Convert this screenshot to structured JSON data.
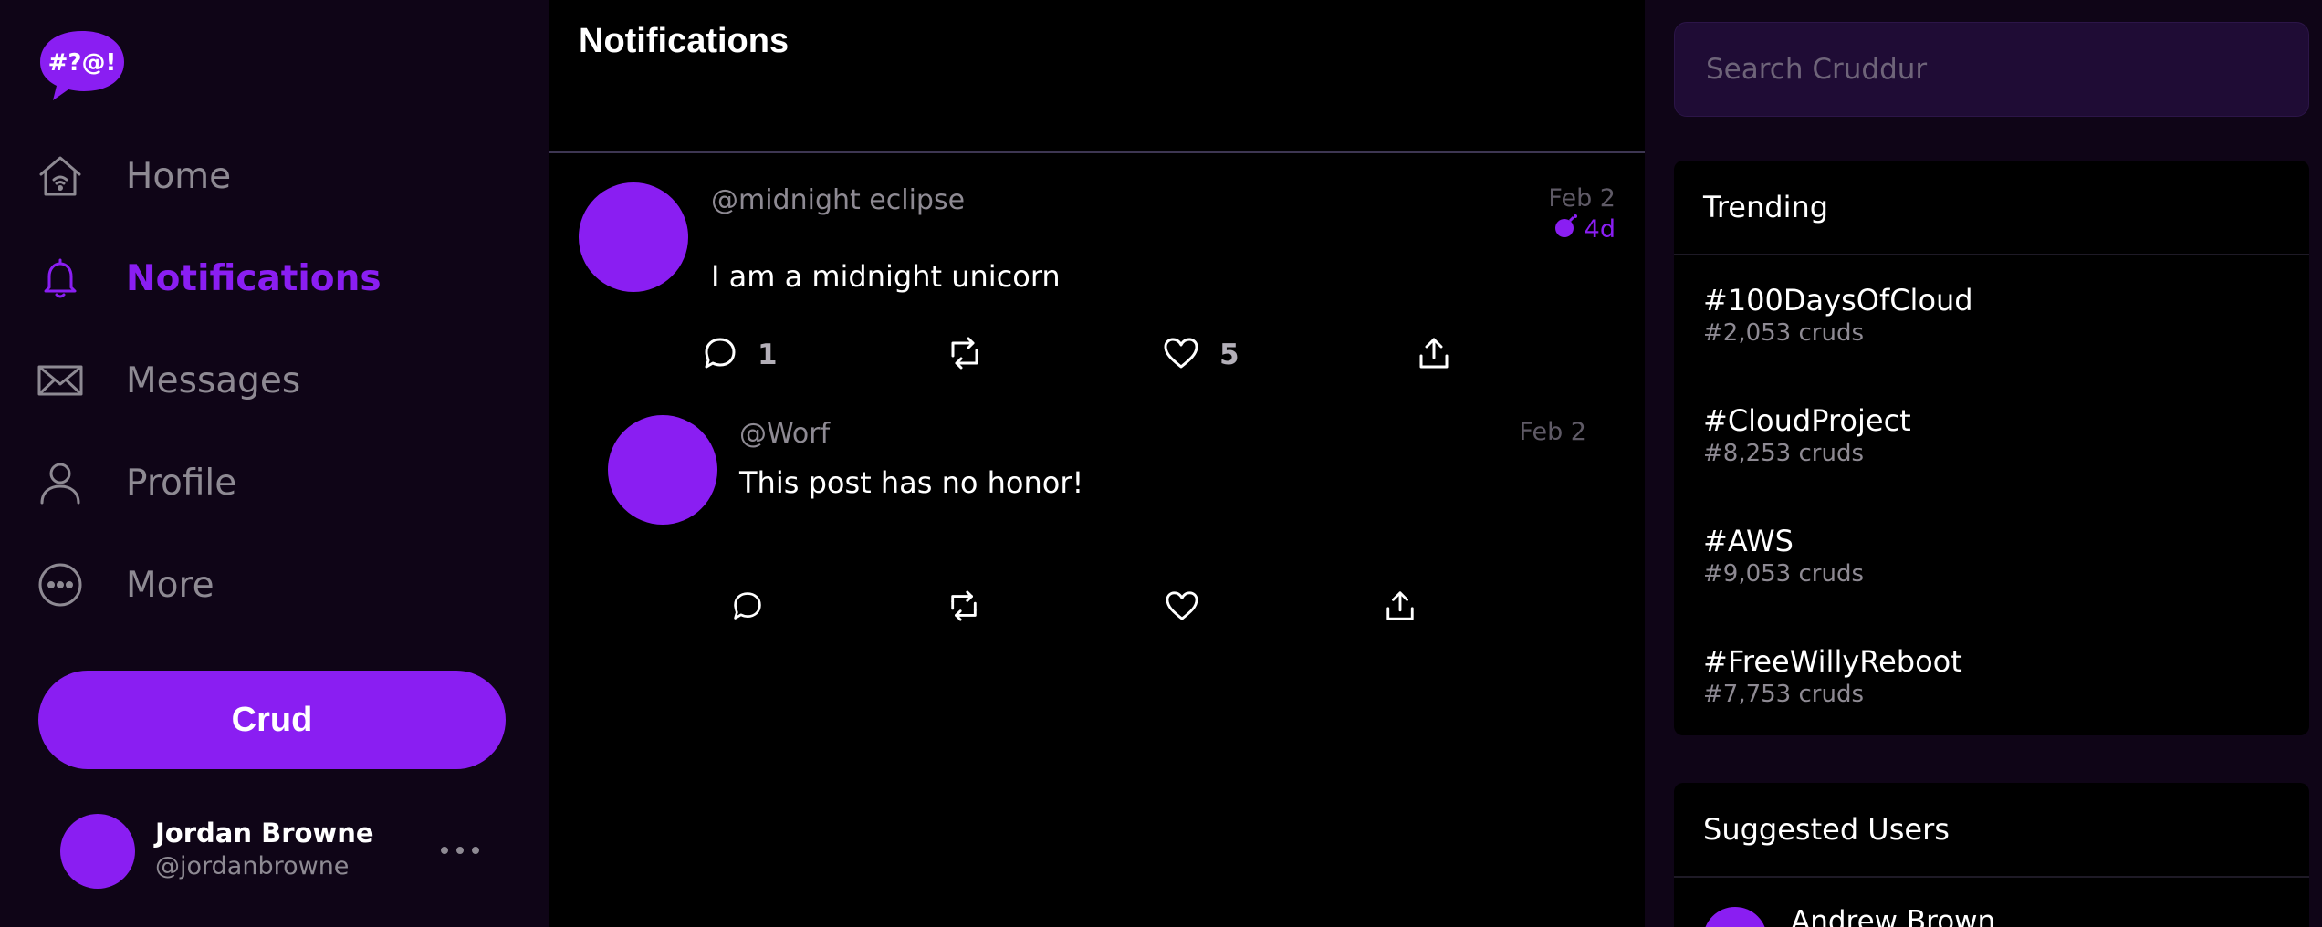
{
  "brand": {
    "logo_text": "#?@!",
    "accent": "#8a1ef2"
  },
  "sidebar": {
    "items": [
      {
        "label": "Home",
        "icon": "home-icon"
      },
      {
        "label": "Notifications",
        "icon": "bell-icon",
        "active": true
      },
      {
        "label": "Messages",
        "icon": "envelope-icon"
      },
      {
        "label": "Profile",
        "icon": "person-icon"
      },
      {
        "label": "More",
        "icon": "more-circle-icon"
      }
    ],
    "crud_button": "Crud",
    "user": {
      "name": "Jordan Browne",
      "handle": "@jordanbrowne"
    }
  },
  "main": {
    "title": "Notifications",
    "posts": [
      {
        "handle": "@midnight eclipse",
        "date": "Feb 2",
        "ttl": "4d",
        "message": "I am a midnight unicorn",
        "reply_count": "1",
        "like_count": "5"
      },
      {
        "handle": "@Worf",
        "date": "Feb 2",
        "message": "This post has no honor!"
      }
    ]
  },
  "search": {
    "placeholder": "Search Cruddur"
  },
  "trending": {
    "title": "Trending",
    "items": [
      {
        "tag": "#100DaysOfCloud",
        "count": "#2,053 cruds"
      },
      {
        "tag": "#CloudProject",
        "count": "#8,253 cruds"
      },
      {
        "tag": "#AWS",
        "count": "#9,053 cruds"
      },
      {
        "tag": "#FreeWillyReboot",
        "count": "#7,753 cruds"
      }
    ]
  },
  "suggested": {
    "title": "Suggested Users",
    "users": [
      {
        "name": "Andrew Brown"
      }
    ]
  }
}
